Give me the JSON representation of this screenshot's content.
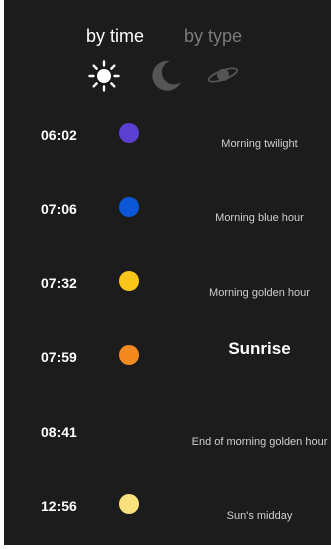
{
  "tabs": [
    {
      "label": "by time",
      "active": true
    },
    {
      "label": "by type",
      "active": false
    }
  ],
  "mode_icons": [
    {
      "name": "sun-icon",
      "color": "#ffffff"
    },
    {
      "name": "moon-icon",
      "color": "#555555"
    },
    {
      "name": "planet-icon",
      "color": "#555555"
    }
  ],
  "events": [
    {
      "time": "06:02",
      "label": "Morning twilight",
      "dot_color": "#5b3fd0",
      "emphasis": false
    },
    {
      "time": "07:06",
      "label": "Morning blue hour",
      "dot_color": "#0c57d6",
      "emphasis": false
    },
    {
      "time": "07:32",
      "label": "Morning golden hour",
      "dot_color": "#f9c719",
      "emphasis": false
    },
    {
      "time": "07:59",
      "label": "Sunrise",
      "dot_color": "#f3891f",
      "emphasis": true
    },
    {
      "time": "08:41",
      "label": "End of morning golden hour",
      "dot_color": null,
      "emphasis": false
    },
    {
      "time": "12:56",
      "label": "Sun's midday",
      "dot_color": "#fbe07e",
      "emphasis": false
    }
  ],
  "colors": {
    "background": "#1c1c1c",
    "text": "#ffffff",
    "inactive": "#7a7a7a",
    "secondary_text": "#cfcfcf"
  }
}
